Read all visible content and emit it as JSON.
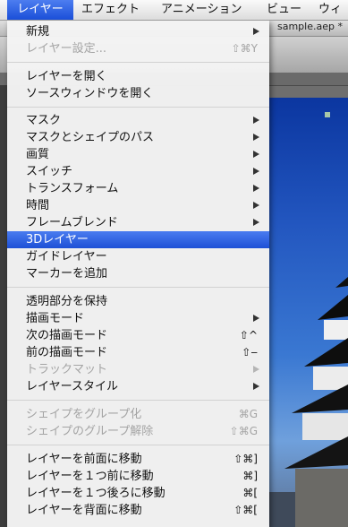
{
  "menubar": {
    "items": [
      "レイヤー",
      "エフェクト",
      "アニメーション",
      "ビュー",
      "ウィ"
    ]
  },
  "window": {
    "document_title": "sample.aep *"
  },
  "colors": {
    "highlight": "#1d50d6",
    "menubar_active": "#1a4fd8"
  },
  "layer_menu": {
    "new": {
      "label": "新規",
      "submenu": true
    },
    "layer_settings": {
      "label": "レイヤー設定...",
      "shortcut": "⇧⌘Y",
      "disabled": true
    },
    "open_layer": {
      "label": "レイヤーを開く"
    },
    "open_source": {
      "label": "ソースウィンドウを開く"
    },
    "mask": {
      "label": "マスク",
      "submenu": true
    },
    "mask_shape_path": {
      "label": "マスクとシェイプのパス",
      "submenu": true
    },
    "quality": {
      "label": "画質",
      "submenu": true
    },
    "switches": {
      "label": "スイッチ",
      "submenu": true
    },
    "transform": {
      "label": "トランスフォーム",
      "submenu": true
    },
    "time": {
      "label": "時間",
      "submenu": true
    },
    "frame_blend": {
      "label": "フレームブレンド",
      "submenu": true
    },
    "layer_3d": {
      "label": "3Dレイヤー",
      "highlighted": true
    },
    "guide_layer": {
      "label": "ガイドレイヤー"
    },
    "add_marker": {
      "label": "マーカーを追加"
    },
    "preserve_transparency": {
      "label": "透明部分を保持"
    },
    "blending_mode": {
      "label": "描画モード",
      "submenu": true
    },
    "next_blend_mode": {
      "label": "次の描画モード",
      "shortcut": "⇧^"
    },
    "prev_blend_mode": {
      "label": "前の描画モード",
      "shortcut": "⇧‒"
    },
    "track_matte": {
      "label": "トラックマット",
      "submenu": true,
      "disabled": true
    },
    "layer_styles": {
      "label": "レイヤースタイル",
      "submenu": true
    },
    "group_shapes": {
      "label": "シェイプをグループ化",
      "shortcut": "⌘G",
      "disabled": true
    },
    "ungroup_shapes": {
      "label": "シェイプのグループ解除",
      "shortcut": "⇧⌘G",
      "disabled": true
    },
    "bring_to_front": {
      "label": "レイヤーを前面に移動",
      "shortcut": "⇧⌘]"
    },
    "bring_forward": {
      "label": "レイヤーを１つ前に移動",
      "shortcut": "⌘]"
    },
    "send_backward": {
      "label": "レイヤーを１つ後ろに移動",
      "shortcut": "⌘["
    },
    "send_to_back": {
      "label": "レイヤーを背面に移動",
      "shortcut": "⇧⌘["
    }
  }
}
